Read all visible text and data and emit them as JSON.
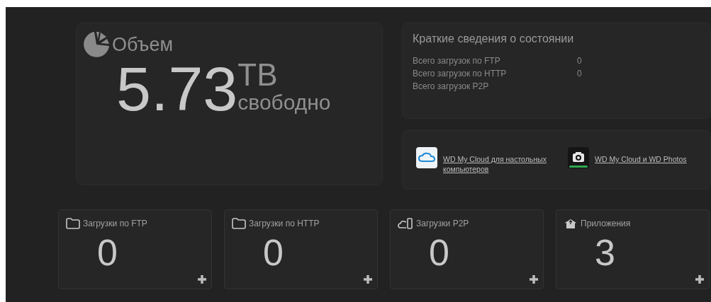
{
  "volume": {
    "title": "Объем",
    "value": "5.73",
    "unit": "TB",
    "note": "свободно"
  },
  "summary": {
    "title": "Краткие сведения о состоянии",
    "rows": [
      {
        "label": "Всего загрузок по FTP",
        "value": "0"
      },
      {
        "label": "Всего загрузок по HTTP",
        "value": "0"
      },
      {
        "label": "Всего загрузок P2P",
        "value": ""
      }
    ]
  },
  "apps_links": [
    {
      "kind": "cloud",
      "label": "WD My Cloud для настольных компьютеров "
    },
    {
      "kind": "photos",
      "label": "WD My Cloud и WD Photos"
    }
  ],
  "tiles": [
    {
      "kind": "folder",
      "title": "Загрузки по FTP",
      "count": "0"
    },
    {
      "kind": "folder",
      "title": "Загрузки по HTTP",
      "count": "0"
    },
    {
      "kind": "p2p",
      "title": "Загрузки P2P",
      "count": "0"
    },
    {
      "kind": "apps",
      "title": "Приложения",
      "count": "3"
    }
  ]
}
